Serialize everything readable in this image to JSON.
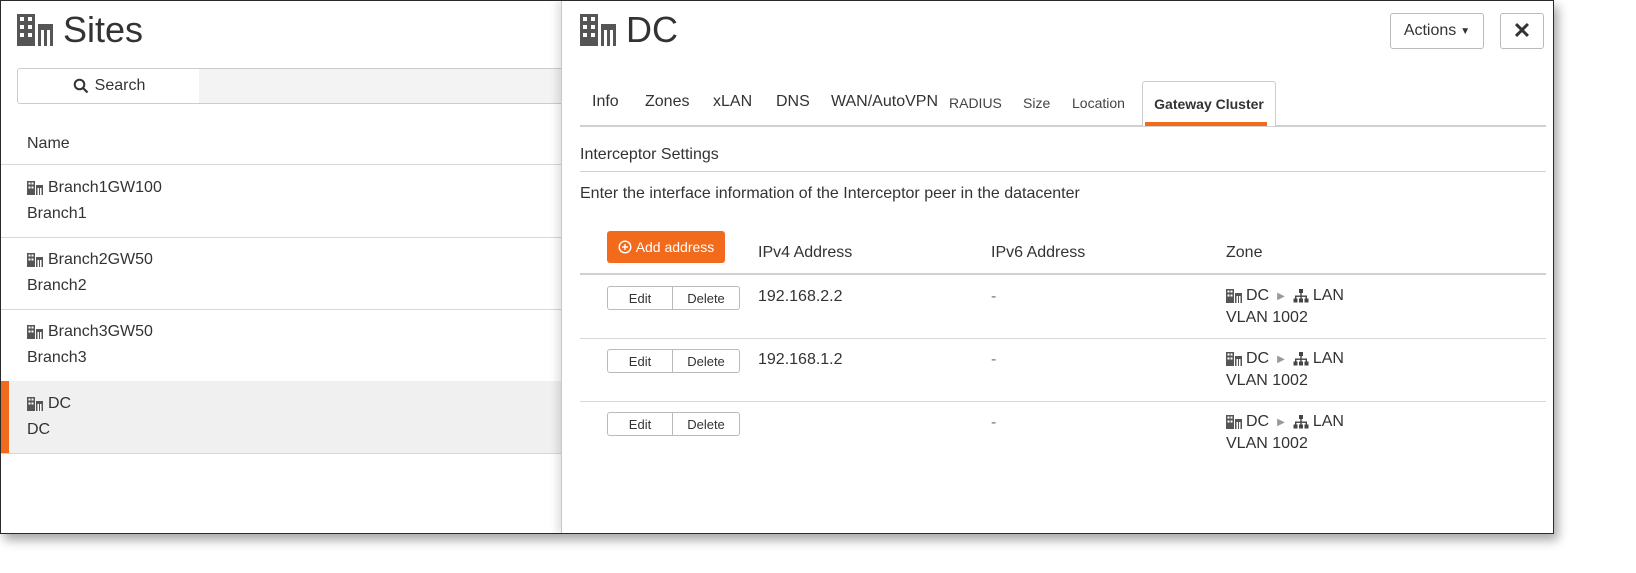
{
  "sites_panel": {
    "title": "Sites",
    "search_label": "Search",
    "column_name": "Name",
    "sites": [
      {
        "name": "Branch1GW100",
        "subtitle": "Branch1"
      },
      {
        "name": "Branch2GW50",
        "subtitle": "Branch2"
      },
      {
        "name": "Branch3GW50",
        "subtitle": "Branch3"
      },
      {
        "name": "DC",
        "subtitle": "DC",
        "selected": true
      }
    ]
  },
  "detail": {
    "title": "DC",
    "actions_label": "Actions",
    "close_label": "✕",
    "tabs": [
      "Info",
      "Zones",
      "xLAN",
      "DNS",
      "WAN/AutoVPN",
      "RADIUS",
      "Size",
      "Location",
      "Gateway Cluster"
    ],
    "active_tab": "Gateway Cluster",
    "section_title": "Interceptor Settings",
    "description": "Enter the interface information of the Interceptor peer in the datacenter",
    "add_button_label": "Add address",
    "columns": {
      "ipv4": "IPv4 Address",
      "ipv6": "IPv6 Address",
      "zone": "Zone"
    },
    "edit_label": "Edit",
    "delete_label": "Delete",
    "rows": [
      {
        "ipv4": "192.168.2.2",
        "ipv6": "-",
        "zone_site": "DC",
        "zone_lan": "LAN",
        "zone_vlan": "VLAN 1002"
      },
      {
        "ipv4": "192.168.1.2",
        "ipv6": "-",
        "zone_site": "DC",
        "zone_lan": "LAN",
        "zone_vlan": "VLAN 1002"
      },
      {
        "ipv4": "",
        "ipv6": "-",
        "zone_site": "DC",
        "zone_lan": "LAN",
        "zone_vlan": "VLAN 1002"
      }
    ]
  },
  "colors": {
    "accent": "#f26a1b",
    "selected_row": "#f0f0f0"
  }
}
